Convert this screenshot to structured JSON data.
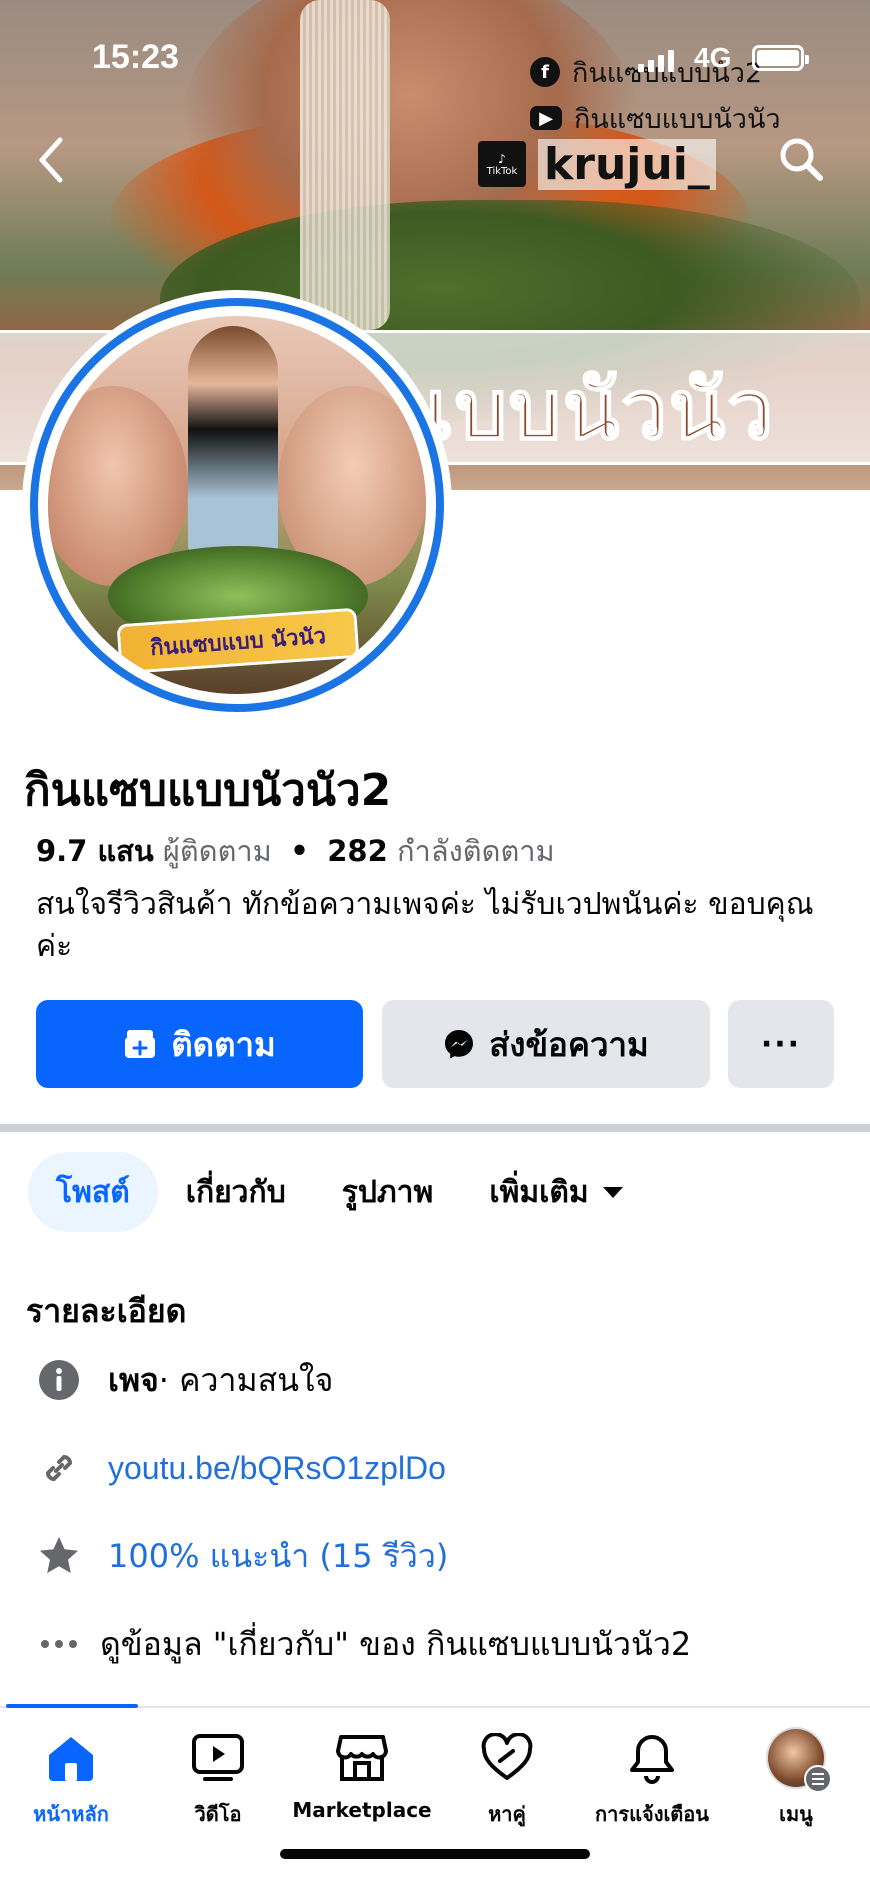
{
  "status_bar": {
    "time": "15:23",
    "network": "4G"
  },
  "cover": {
    "banner_text": "แบบนัวนัว",
    "social": [
      {
        "icon": "facebook-icon",
        "label": "กินแซบแบบนัว2"
      },
      {
        "icon": "youtube-icon",
        "label": "กินแซบแบบนัวนัว"
      },
      {
        "icon": "tiktok-icon",
        "label": "krujui_",
        "badge": "TikTok"
      }
    ]
  },
  "avatar": {
    "logo_text": "กินแซบแบบ นัวนัว"
  },
  "profile": {
    "name": "กินแซบแบบนัวนัว2",
    "followers_value": "9.7 แสน",
    "followers_label": "ผู้ติดตาม",
    "separator": "•",
    "following_value": "282",
    "following_label": "กำลังติดตาม",
    "bio": "สนใจรีวิวสินค้า ทักข้อความเพจค่ะ ไม่รับเวปพนันค่ะ ขอบคุณค่ะ"
  },
  "actions": {
    "follow": "ติดตาม",
    "message": "ส่งข้อความ",
    "more": "···"
  },
  "tabs": [
    {
      "label": "โพสต์",
      "active": true
    },
    {
      "label": "เกี่ยวกับ",
      "active": false
    },
    {
      "label": "รูปภาพ",
      "active": false
    },
    {
      "label": "เพิ่มเติม",
      "active": false
    }
  ],
  "details": {
    "title": "รายละเอียด",
    "category_bold": "เพจ",
    "category_rest": " · ความสนใจ",
    "link": "youtu.be/bQRsO1zplDo",
    "rating": "100% แนะนำ (15 รีวิว)",
    "about_more": "ดูข้อมูล \"เกี่ยวกับ\" ของ กินแซบแบบนัวนัว2"
  },
  "nav": [
    {
      "label": "หน้าหลัก",
      "icon": "home-icon",
      "active": true
    },
    {
      "label": "วิดีโอ",
      "icon": "video-icon",
      "active": false
    },
    {
      "label": "Marketplace",
      "icon": "marketplace-icon",
      "active": false
    },
    {
      "label": "หาคู่",
      "icon": "dating-heart-icon",
      "active": false
    },
    {
      "label": "การแจ้งเตือน",
      "icon": "bell-icon",
      "active": false
    },
    {
      "label": "เมนู",
      "icon": "menu-avatar",
      "active": false
    }
  ],
  "colors": {
    "accent": "#0866ff",
    "link": "#216fdb",
    "secondary_text": "#65676b",
    "button_gray": "#e4e6eb"
  }
}
